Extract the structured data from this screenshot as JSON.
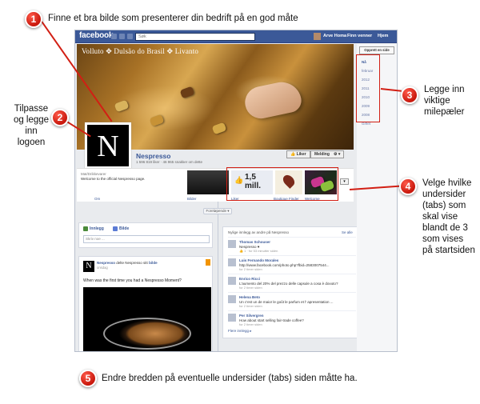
{
  "annotations": [
    {
      "num": "1",
      "text": "Finne et bra bilde som presenterer din bedrift på en god måte"
    },
    {
      "num": "2",
      "lines": [
        "Tilpasse",
        "og legge",
        "inn logoen"
      ]
    },
    {
      "num": "3",
      "lines": [
        "Legge inn",
        "viktige",
        "milepæler"
      ]
    },
    {
      "num": "4",
      "lines": [
        "Velge hvilke",
        "undersider",
        "(tabs) som",
        "skal vise",
        "blandt de 3",
        "som vises",
        "på startsiden"
      ]
    },
    {
      "num": "5",
      "text": "Endre bredden på eventuelle undersider (tabs) siden måtte ha."
    }
  ],
  "topbar": {
    "logo": "facebook",
    "search_placeholder": "Søk",
    "user_name": "Arve Homa",
    "find_friends": "Finn venner",
    "home": "Hjem"
  },
  "cover": {
    "brand_text": "Volluto ✥ Dulsão do Brasil ✥ Livanto"
  },
  "page": {
    "logo_letter": "N",
    "name": "Nespresso",
    "stats": "1 596 819 liker · 46 965 snakker om dette",
    "like_button": "👍 Liker",
    "message_button": "Melding",
    "settings_button": "⚙ ▾",
    "category": "Mat/Drikkevarer",
    "about": "Welcome to the official Nespresso page.",
    "about_link": "Om"
  },
  "tabs": [
    {
      "label": "Bilder"
    },
    {
      "label": "Liker",
      "value": "1,5",
      "unit": "mill."
    },
    {
      "label": "Boutique Finder"
    },
    {
      "label": "Welcome"
    }
  ],
  "tabs_more": "▾",
  "now_label": "Foreløpende ▾",
  "sidebar": {
    "create_button": "Opprett en side",
    "years": [
      "Nå",
      "februar",
      "2012",
      "2011",
      "2010",
      "2009",
      "2008",
      "Grflet"
    ]
  },
  "composer": {
    "tab_post": "Innlegg",
    "tab_photo": "Bilde",
    "placeholder": "Skriv noe ..."
  },
  "post": {
    "author": "Nespresso",
    "action": "delte Nespresso sitt",
    "object": "bilde",
    "time": "onsdag",
    "question": "When was the first time you had a Nespresso Moment?"
  },
  "recent": {
    "title": "Nylige innlegg av andre på Nespresso",
    "see_all": "Se alle",
    "entries": [
      {
        "name": "Thomas Schouser",
        "text": "Nespresso ♥",
        "time": "👍 1 · for 53 minutter siden"
      },
      {
        "name": "Luis Fernando Morales",
        "text": "http://www.facebook.com/photo.php?fbid=2583007544...",
        "time": "for 2 timer siden"
      },
      {
        "name": "Enrico Ricci",
        "text": "L'aumento del 20% del prezzo delle capsule a cosa è dovuto?",
        "time": "for 2 timer siden"
      },
      {
        "name": "Helena Beto",
        "text": "Un c'est un de maior le goût le parfum et l' apresentation ...",
        "time": "for 2 timer siden"
      },
      {
        "name": "Per Silvergren",
        "text": "How about start selling fair-trade coffee?",
        "time": "for 2 timer siden"
      }
    ],
    "more": "Flere innlegg ▸"
  }
}
